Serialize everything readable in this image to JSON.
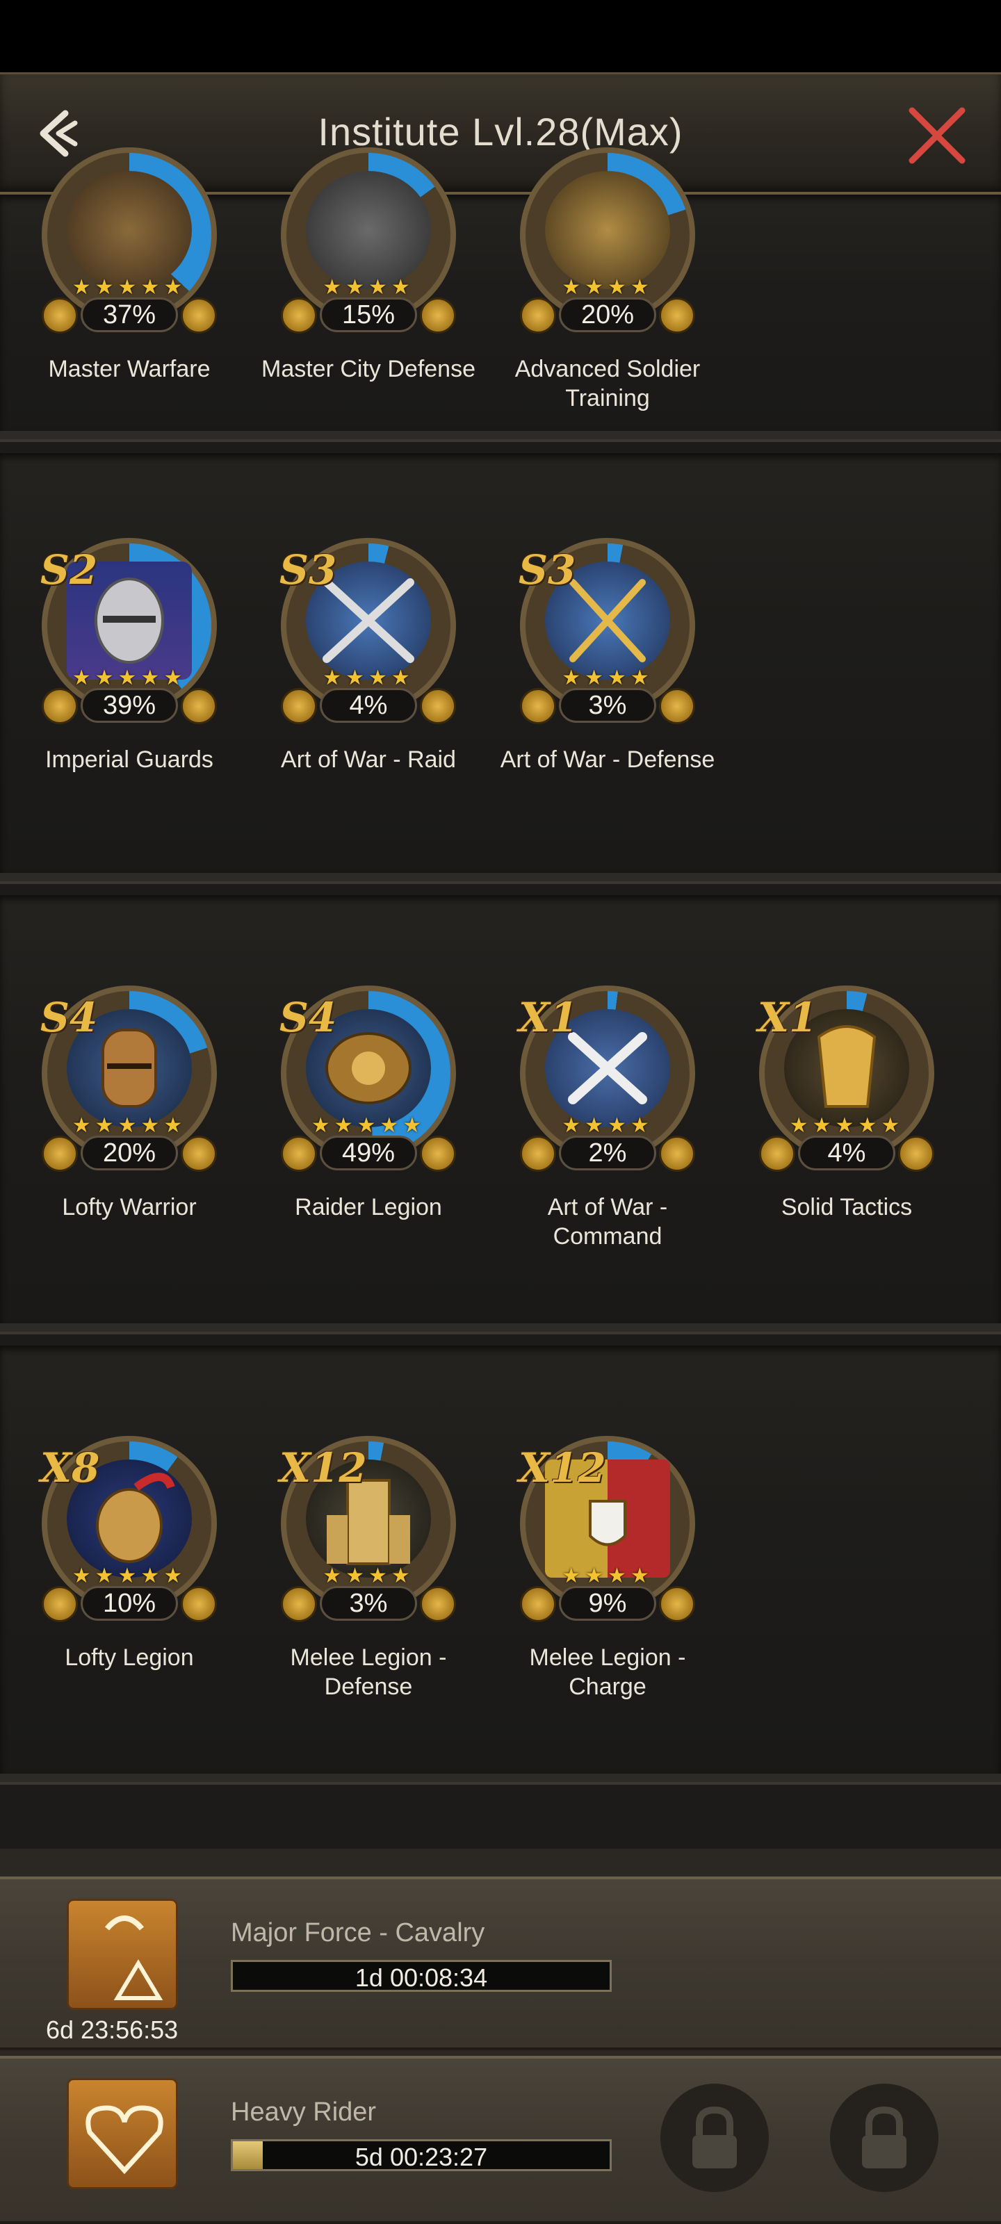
{
  "header": {
    "title": "Institute Lvl.28(Max)"
  },
  "sections": [
    {
      "tiles": [
        {
          "label": "Master Warfare",
          "percent": "37%",
          "tier": "",
          "stars": "★★★★★"
        },
        {
          "label": "Master City Defense",
          "percent": "15%",
          "tier": "",
          "stars": "★★★★"
        },
        {
          "label": "Advanced Soldier Training",
          "percent": "20%",
          "tier": "",
          "stars": "★★★★"
        }
      ]
    },
    {
      "tiles": [
        {
          "label": "Imperial Guards",
          "percent": "39%",
          "tier": "S2",
          "stars": "★★★★★"
        },
        {
          "label": "Art of War - Raid",
          "percent": "4%",
          "tier": "S3",
          "stars": "★★★★"
        },
        {
          "label": "Art of War - Defense",
          "percent": "3%",
          "tier": "S3",
          "stars": "★★★★"
        }
      ]
    },
    {
      "tiles": [
        {
          "label": "Lofty Warrior",
          "percent": "20%",
          "tier": "S4",
          "stars": "★★★★★"
        },
        {
          "label": "Raider Legion",
          "percent": "49%",
          "tier": "S4",
          "stars": "★★★★★"
        },
        {
          "label": "Art of War - Command",
          "percent": "2%",
          "tier": "X1",
          "stars": "★★★★"
        },
        {
          "label": "Solid Tactics",
          "percent": "4%",
          "tier": "X1",
          "stars": "★★★★★"
        }
      ]
    },
    {
      "tiles": [
        {
          "label": "Lofty Legion",
          "percent": "10%",
          "tier": "X8",
          "stars": "★★★★★"
        },
        {
          "label": "Melee Legion - Defense",
          "percent": "3%",
          "tier": "X12",
          "stars": "★★★★"
        },
        {
          "label": "Melee Legion - Charge",
          "percent": "9%",
          "tier": "X12",
          "stars": "★★★★"
        }
      ]
    }
  ],
  "queue": [
    {
      "name": "Major Force - Cavalry",
      "bar_time": "1d 00:08:34",
      "progress": 0.0,
      "remaining": "6d 23:56:53",
      "icon": "horseshoe-triangle-icon"
    },
    {
      "name": "Heavy Rider",
      "bar_time": "5d 00:23:27",
      "progress": 0.08,
      "remaining": "",
      "icon": "horseshoe-heart-icon"
    }
  ],
  "colors": {
    "accent_gold": "#e8b945",
    "close_red": "#d6483f",
    "ring_blue": "#2a8fd6"
  }
}
